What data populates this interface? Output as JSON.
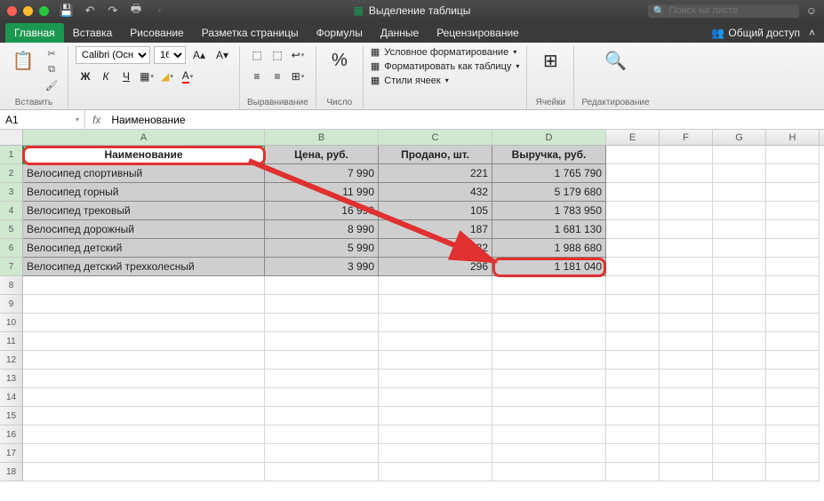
{
  "window": {
    "title": "Выделение таблицы"
  },
  "search": {
    "placeholder": "Поиск на листе"
  },
  "tabs": {
    "items": [
      "Главная",
      "Вставка",
      "Рисование",
      "Разметка страницы",
      "Формулы",
      "Данные",
      "Рецензирование"
    ],
    "active": 0,
    "share": "Общий доступ"
  },
  "ribbon": {
    "paste": "Вставить",
    "font": {
      "name": "Calibri (Осн...",
      "size": "16"
    },
    "align_label": "Выравнивание",
    "number_label": "Число",
    "percent": "%",
    "styles": {
      "cond": "Условное форматирование",
      "table": "Форматировать как таблицу",
      "cell": "Стили ячеек"
    },
    "cells_label": "Ячейки",
    "edit_label": "Редактирование"
  },
  "namebox": "A1",
  "formula": "Наименование",
  "columns": [
    "A",
    "B",
    "C",
    "D",
    "E",
    "F",
    "G",
    "H"
  ],
  "table": {
    "headers": [
      "Наименование",
      "Цена, руб.",
      "Продано, шт.",
      "Выручка, руб."
    ],
    "rows": [
      [
        "Велосипед спортивный",
        "7 990",
        "221",
        "1 765 790"
      ],
      [
        "Велосипед горный",
        "11 990",
        "432",
        "5 179 680"
      ],
      [
        "Велосипед трековый",
        "16 990",
        "105",
        "1 783 950"
      ],
      [
        "Велосипед дорожный",
        "8 990",
        "187",
        "1 681 130"
      ],
      [
        "Велосипед детский",
        "5 990",
        "332",
        "1 988 680"
      ],
      [
        "Велосипед детский трехколесный",
        "3 990",
        "296",
        "1 181 040"
      ]
    ]
  },
  "colors": {
    "accent": "#1a9850",
    "annotation": "#e03030"
  }
}
